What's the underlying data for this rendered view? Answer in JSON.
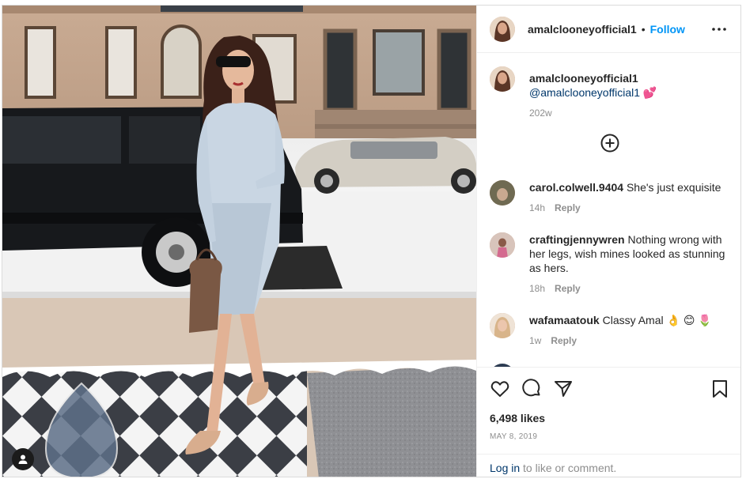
{
  "post": {
    "author": "amalclooneyofficial1",
    "follow_label": "Follow",
    "separator": "•",
    "caption": {
      "username": "amalclooneyofficial1",
      "mention": "@amalclooneyofficial1",
      "emoji": "💕",
      "age": "202w"
    },
    "likes": "6,498 likes",
    "date": "MAY 8, 2019"
  },
  "comments": [
    {
      "username": "carol.colwell.9404",
      "text": "She's just exquisite",
      "age": "14h",
      "reply_label": "Reply",
      "avatar_color": "#6f6a52"
    },
    {
      "username": "craftingjennywren",
      "text": "Nothing wrong with her legs, wish mines looked as stunning as hers.",
      "age": "18h",
      "reply_label": "Reply",
      "avatar_color": "#c9a9a0"
    },
    {
      "username": "wafamaatouk",
      "text": "Classy Amal 👌 😊 🌷",
      "age": "1w",
      "reply_label": "Reply",
      "avatar_color": "#d8b48a"
    }
  ],
  "login": {
    "link_label": "Log in",
    "suffix": " to like or comment."
  },
  "icons": {
    "more": "more-options-icon",
    "load_more": "add-circle-icon",
    "like": "heart-icon",
    "comment": "comment-icon",
    "share": "share-icon",
    "save": "bookmark-icon",
    "user_tag": "user-tag-icon"
  },
  "colors": {
    "accent": "#0095f6",
    "text": "#262626",
    "muted": "#8e8e8e",
    "link": "#00376b",
    "border": "#dbdbdb"
  }
}
